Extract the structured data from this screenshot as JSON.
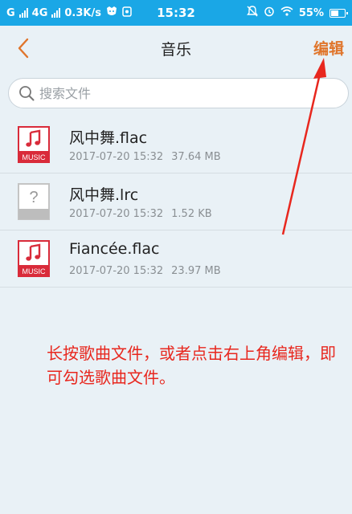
{
  "status_bar": {
    "left_text_1": "G",
    "left_text_2": "4G",
    "speed": "0.3K/s",
    "time": "15:32",
    "battery": "55%"
  },
  "header": {
    "title": "音乐",
    "edit_label": "编辑"
  },
  "search": {
    "placeholder": "搜索文件"
  },
  "files": [
    {
      "name": "风中舞.flac",
      "date": "2017-07-20 15:32",
      "size": "37.64 MB",
      "icon": "music-file-icon",
      "icon_label": "MUSIC"
    },
    {
      "name": "风中舞.lrc",
      "date": "2017-07-20 15:32",
      "size": "1.52 KB",
      "icon": "unknown-file-icon",
      "icon_label": "?"
    },
    {
      "name": "Fiancée.flac",
      "date": "2017-07-20 15:32",
      "size": "23.97 MB",
      "icon": "music-file-icon",
      "icon_label": "MUSIC"
    }
  ],
  "annotation": {
    "text": "长按歌曲文件，或者点击右上角编辑，即可勾选歌曲文件。"
  },
  "colors": {
    "status_bar": "#1aa7e6",
    "accent": "#e0752b",
    "music_icon": "#d92b3a",
    "annotation": "#e8271e"
  }
}
